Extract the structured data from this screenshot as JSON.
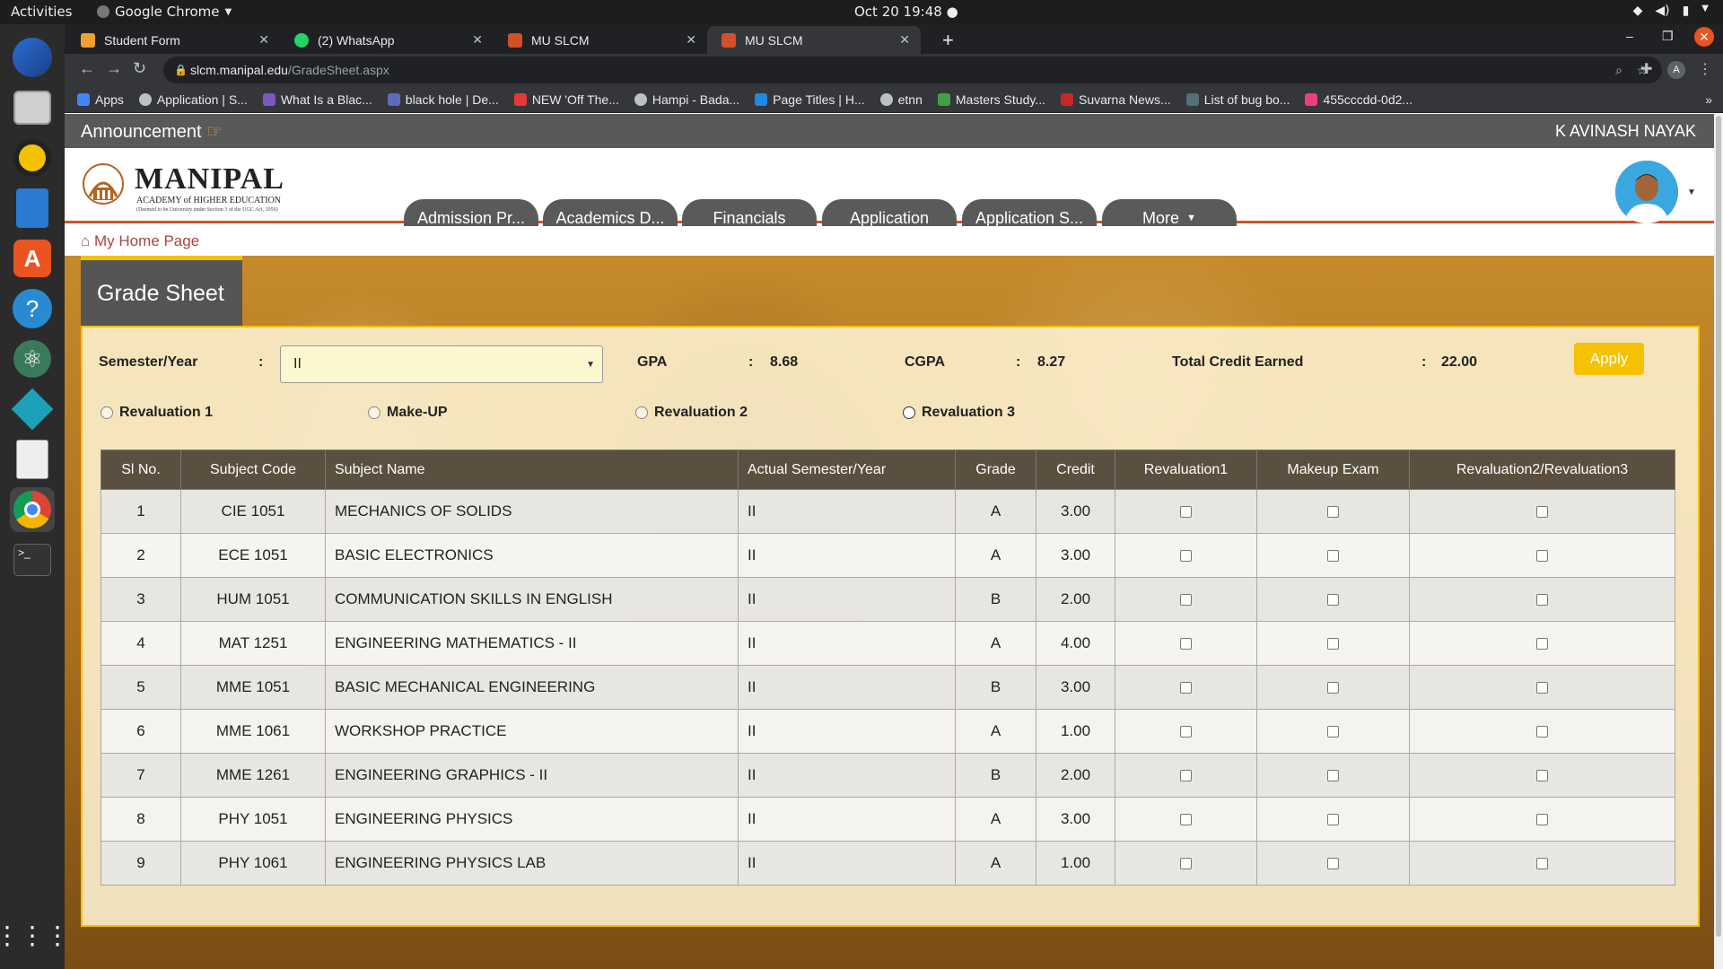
{
  "system_bar": {
    "activities": "Activities",
    "app_name": "Google Chrome",
    "clock": "Oct 20  19:48"
  },
  "browser": {
    "tabs": [
      {
        "title": "Student Form",
        "favicon_color": "#f0a030"
      },
      {
        "title": "(2) WhatsApp",
        "favicon_color": "#25d366"
      },
      {
        "title": "MU SLCM",
        "favicon_color": "#d2502a"
      },
      {
        "title": "MU SLCM",
        "favicon_color": "#d2502a"
      }
    ],
    "url_domain": "slcm.manipal.edu",
    "url_path": "/GradeSheet.aspx",
    "bookmarks": [
      {
        "label": "Apps",
        "color": "#4285f4"
      },
      {
        "label": "Application | S...",
        "color": "#bdc1c6"
      },
      {
        "label": "What Is a Blac...",
        "color": "#7e57c2"
      },
      {
        "label": "black hole | De...",
        "color": "#5c6bc0"
      },
      {
        "label": "NEW 'Off The...",
        "color": "#e53935"
      },
      {
        "label": "Hampi - Bada...",
        "color": "#bdc1c6"
      },
      {
        "label": "Page Titles | H...",
        "color": "#1e88e5"
      },
      {
        "label": "etnn",
        "color": "#bdc1c6"
      },
      {
        "label": "Masters Study...",
        "color": "#43a047"
      },
      {
        "label": "Suvarna News...",
        "color": "#c62828"
      },
      {
        "label": "List of bug bo...",
        "color": "#546e7a"
      },
      {
        "label": "455cccdd-0d2...",
        "color": "#ec407a"
      }
    ]
  },
  "announcement": {
    "label": "Announcement",
    "user_name": "K AVINASH NAYAK"
  },
  "logo": {
    "name": "MANIPAL",
    "subtitle": "ACADEMY of HIGHER EDUCATION",
    "tagline": "(Deemed to be University under Section 3 of the UGC Act, 1956)"
  },
  "nav": {
    "tabs": [
      "Admission Pr...",
      "Academics D...",
      "Financials",
      "Application",
      "Application S...",
      "More"
    ]
  },
  "breadcrumb": {
    "home": "My Home Page"
  },
  "grade_sheet": {
    "title": "Grade Sheet",
    "semester_label": "Semester/Year",
    "semester_value": "II",
    "gpa_label": "GPA",
    "gpa_value": "8.68",
    "cgpa_label": "CGPA",
    "cgpa_value": "8.27",
    "credit_label": "Total Credit Earned",
    "credit_value": "22.00",
    "apply_label": "Apply",
    "radio_options": [
      "Revaluation 1",
      "Make-UP",
      "Revaluation 2",
      "Revaluation 3"
    ],
    "columns": [
      "Sl No.",
      "Subject Code",
      "Subject Name",
      "Actual Semester/Year",
      "Grade",
      "Credit",
      "Revaluation1",
      "Makeup Exam",
      "Revaluation2/Revaluation3"
    ],
    "rows": [
      {
        "sl": "1",
        "code": "CIE 1051",
        "name": "MECHANICS OF SOLIDS",
        "sem": "II",
        "grade": "A",
        "credit": "3.00"
      },
      {
        "sl": "2",
        "code": "ECE 1051",
        "name": "BASIC ELECTRONICS",
        "sem": "II",
        "grade": "A",
        "credit": "3.00"
      },
      {
        "sl": "3",
        "code": "HUM 1051",
        "name": "COMMUNICATION SKILLS IN ENGLISH",
        "sem": "II",
        "grade": "B",
        "credit": "2.00"
      },
      {
        "sl": "4",
        "code": "MAT 1251",
        "name": "ENGINEERING MATHEMATICS - II",
        "sem": "II",
        "grade": "A",
        "credit": "4.00"
      },
      {
        "sl": "5",
        "code": "MME 1051",
        "name": "BASIC MECHANICAL ENGINEERING",
        "sem": "II",
        "grade": "B",
        "credit": "3.00"
      },
      {
        "sl": "6",
        "code": "MME 1061",
        "name": "WORKSHOP PRACTICE",
        "sem": "II",
        "grade": "A",
        "credit": "1.00"
      },
      {
        "sl": "7",
        "code": "MME 1261",
        "name": "ENGINEERING GRAPHICS - II",
        "sem": "II",
        "grade": "B",
        "credit": "2.00"
      },
      {
        "sl": "8",
        "code": "PHY 1051",
        "name": "ENGINEERING PHYSICS",
        "sem": "II",
        "grade": "A",
        "credit": "3.00"
      },
      {
        "sl": "9",
        "code": "PHY 1061",
        "name": "ENGINEERING PHYSICS LAB",
        "sem": "II",
        "grade": "A",
        "credit": "1.00"
      }
    ]
  },
  "colors": {
    "accent_orange": "#d2502a",
    "apply_yellow": "#f6c200",
    "header_gray": "#5b5040"
  }
}
